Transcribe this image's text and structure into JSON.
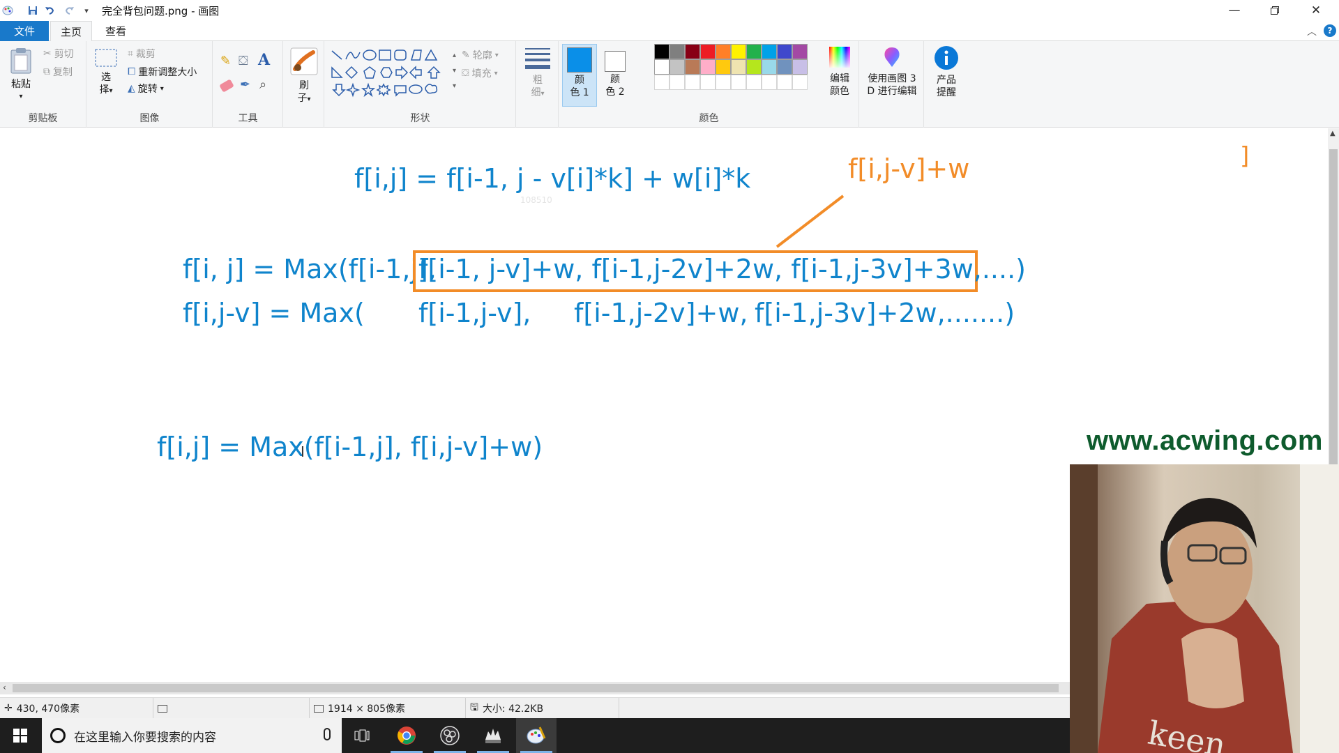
{
  "window": {
    "title": "完全背包问题.png - 画图"
  },
  "tabs": [
    "文件",
    "主页",
    "查看"
  ],
  "ribbon": {
    "clipboard": {
      "paste": "粘贴",
      "cut": "剪切",
      "copy": "复制",
      "label": "剪贴板"
    },
    "image": {
      "select_1": "选",
      "select_2": "择",
      "crop": "裁剪",
      "resize": "重新调整大小",
      "rotate": "旋转",
      "label": "图像"
    },
    "tools": {
      "label": "工具"
    },
    "brushes": {
      "label_1": "刷",
      "label_2": "子"
    },
    "shapes": {
      "outline": "轮廓",
      "fill": "填充",
      "label": "形状"
    },
    "size": {
      "label_1": "粗",
      "label_2": "细"
    },
    "colors": {
      "color1_1": "颜",
      "color1_2": "色 1",
      "color2_1": "颜",
      "color2_2": "色 2",
      "edit_1": "编辑",
      "edit_2": "颜色",
      "label": "颜色",
      "palette_row1": [
        "#000000",
        "#7f7f7f",
        "#880015",
        "#ed1c24",
        "#ff7f27",
        "#fff200",
        "#22b14c",
        "#00a2e8",
        "#3f48cc",
        "#a349a4"
      ],
      "palette_row2": [
        "#ffffff",
        "#c3c3c3",
        "#b97a57",
        "#ffaec9",
        "#ffc90e",
        "#efe4b0",
        "#b5e61d",
        "#99d9ea",
        "#7092be",
        "#c8bfe7"
      ],
      "color1_value": "#0a8fe8",
      "color2_value": "#ffffff"
    },
    "paint3d": {
      "line1": "使用画图 3",
      "line2": "D 进行编辑"
    },
    "product": {
      "line1": "产品",
      "line2": "提醒"
    }
  },
  "canvas": {
    "formula1": "f[i,j] = f[i-1, j - v[i]*k] + w[i]*k",
    "faint_number": "108510",
    "annotation": "f[i,j-v]+w",
    "formula2_prefix": "f[i, j] = Max(f[i-1,j],",
    "formula2_boxed": "f[i-1, j-v]+w, f[i-1,j-2v]+2w, f[i-1,j-3v]+3w,....)",
    "formula3_a": "f[i,j-v] = Max(",
    "formula3_b": "f[i-1,j-v],",
    "formula3_c": "f[i-1,j-2v]+w,",
    "formula3_d": "f[i-1,j-3v]+2w,.......)",
    "formula4": "f[i,j] = Max(f[i-1,j], f[i,j-v]+w)",
    "edge_glyph": "]",
    "watermark": "www.acwing.com",
    "ink_color": "#0f84cc",
    "highlight_color": "#f28c28"
  },
  "status": {
    "cursor": "430, 470像素",
    "dimensions": "1914 × 805像素",
    "size": "大小: 42.2KB"
  },
  "taskbar": {
    "search_placeholder": "在这里输入你要搜索的内容"
  }
}
